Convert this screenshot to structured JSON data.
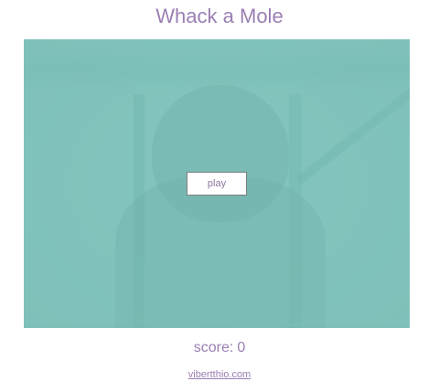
{
  "app": {
    "title": "Whack a Mole"
  },
  "game": {
    "play_label": "play"
  },
  "score": {
    "label": "score:",
    "value": "0"
  },
  "footer": {
    "link_text": "vibertthio.com"
  },
  "colors": {
    "accent": "#9b7fb3",
    "stage_background": "#82c4bd",
    "button_background": "#ffffff",
    "button_border": "#7f7f7f"
  }
}
